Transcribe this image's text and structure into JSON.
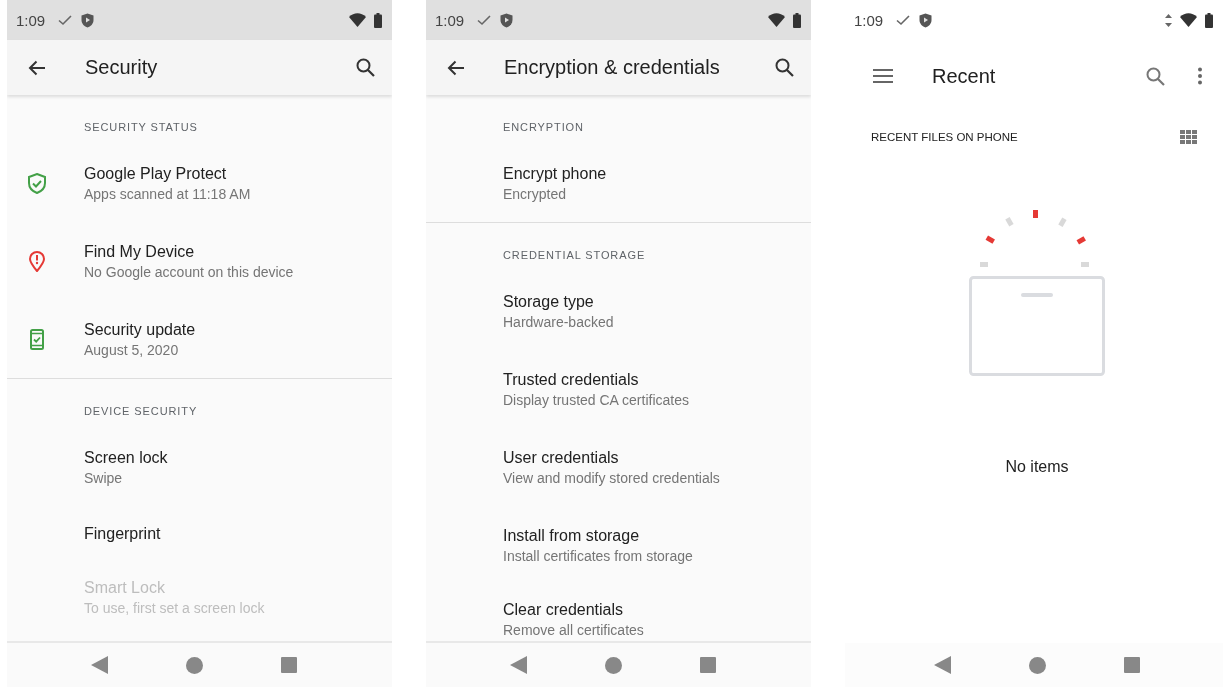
{
  "screens": [
    {
      "kind": "settings",
      "status_bar": {
        "time": "1:09",
        "data_activity": false
      },
      "toolbar": {
        "title": "Security"
      },
      "sections": [
        {
          "header": "SECURITY STATUS",
          "items": [
            {
              "title": "Google Play Protect",
              "subtitle": "Apps scanned at 11:18 AM",
              "disabled": false
            },
            {
              "title": "Find My Device",
              "subtitle": "No Google account on this device",
              "disabled": false
            },
            {
              "title": "Security update",
              "subtitle": "August 5, 2020",
              "disabled": false
            }
          ]
        },
        {
          "header": "DEVICE SECURITY",
          "items": [
            {
              "title": "Screen lock",
              "subtitle": "Swipe",
              "disabled": false
            },
            {
              "title": "Fingerprint",
              "disabled": false
            },
            {
              "title": "Smart Lock",
              "subtitle": "To use, first set a screen lock",
              "disabled": true
            }
          ]
        }
      ]
    },
    {
      "kind": "settings",
      "status_bar": {
        "time": "1:09",
        "data_activity": false
      },
      "toolbar": {
        "title": "Encryption & credentials"
      },
      "sections": [
        {
          "header": "ENCRYPTION",
          "items": [
            {
              "title": "Encrypt phone",
              "subtitle": "Encrypted",
              "disabled": false
            }
          ]
        },
        {
          "header": "CREDENTIAL STORAGE",
          "items": [
            {
              "title": "Storage type",
              "subtitle": "Hardware-backed",
              "disabled": false
            },
            {
              "title": "Trusted credentials",
              "subtitle": "Display trusted CA certificates",
              "disabled": false
            },
            {
              "title": "User credentials",
              "subtitle": "View and modify stored credentials",
              "disabled": false
            },
            {
              "title": "Install from storage",
              "subtitle": "Install certificates from storage",
              "disabled": false
            },
            {
              "title": "Clear credentials",
              "subtitle": "Remove all certificates",
              "disabled": false
            }
          ]
        }
      ]
    },
    {
      "kind": "files",
      "status_bar": {
        "time": "1:09",
        "data_activity": true
      },
      "toolbar": {
        "title": "Recent"
      },
      "subheader": "RECENT FILES ON PHONE",
      "empty_message": "No items"
    }
  ]
}
